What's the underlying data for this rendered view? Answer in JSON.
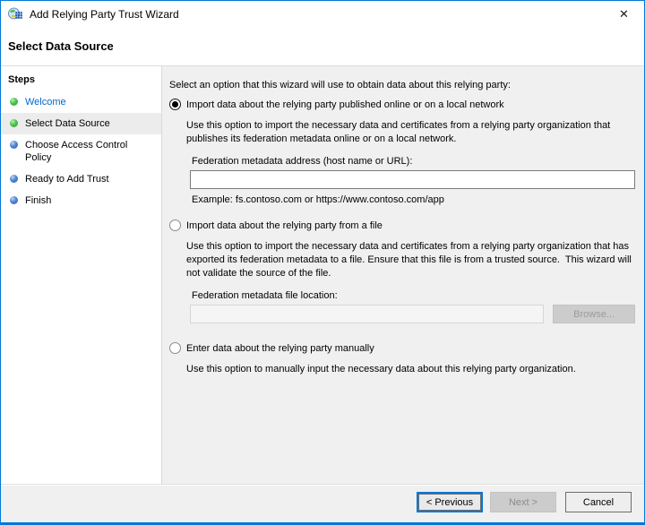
{
  "window": {
    "title": "Add Relying Party Trust Wizard",
    "close_glyph": "✕"
  },
  "header": {
    "title": "Select Data Source"
  },
  "sidebar": {
    "title": "Steps",
    "items": [
      {
        "label": "Welcome"
      },
      {
        "label": "Select Data Source"
      },
      {
        "label": "Choose Access Control Policy"
      },
      {
        "label": "Ready to Add Trust"
      },
      {
        "label": "Finish"
      }
    ]
  },
  "content": {
    "intro": "Select an option that this wizard will use to obtain data about this relying party:",
    "option_online": {
      "label": "Import data about the relying party published online or on a local network",
      "description": "Use this option to import the necessary data and certificates from a relying party organization that publishes its federation metadata online or on a local network.",
      "field_label": "Federation metadata address (host name or URL):",
      "field_value": "",
      "example": "Example: fs.contoso.com or https://www.contoso.com/app"
    },
    "option_file": {
      "label": "Import data about the relying party from a file",
      "description": "Use this option to import the necessary data and certificates from a relying party organization that has exported its federation metadata to a file. Ensure that this file is from a trusted source.  This wizard will not validate the source of the file.",
      "field_label": "Federation metadata file location:",
      "field_value": "",
      "browse_label": "Browse..."
    },
    "option_manual": {
      "label": "Enter data about the relying party manually",
      "description": "Use this option to manually input the necessary data about this relying party organization."
    }
  },
  "footer": {
    "previous": "< Previous",
    "next": "Next >",
    "cancel": "Cancel"
  },
  "colors": {
    "accent": "#0078d7",
    "step_completed": "#2da02d",
    "step_upcoming": "#2d62b8",
    "welcome_link": "#0066cc"
  }
}
